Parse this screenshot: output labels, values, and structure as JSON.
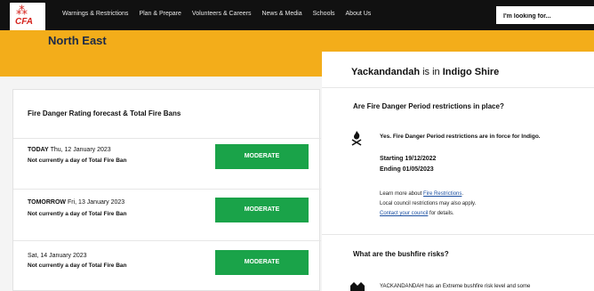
{
  "nav": {
    "logo_text": "CFA",
    "items": [
      "Warnings & Restrictions",
      "Plan & Prepare",
      "Volunteers & Careers",
      "News & Media",
      "Schools",
      "About Us"
    ],
    "search_placeholder": "I'm looking for..."
  },
  "header": {
    "region": "North East"
  },
  "forecast": {
    "title": "Fire Danger Rating forecast & Total Fire Bans",
    "days": [
      {
        "label": "TODAY",
        "date": "Thu, 12 January 2023",
        "tfb": "Not currently a day of Total Fire Ban",
        "rating": "MODERATE"
      },
      {
        "label": "TOMORROW",
        "date": "Fri, 13 January 2023",
        "tfb": "Not currently a day of Total Fire Ban",
        "rating": "MODERATE"
      },
      {
        "label": "",
        "date": "Sat, 14 January 2023",
        "tfb": "Not currently a day of Total Fire Ban",
        "rating": "MODERATE"
      }
    ]
  },
  "location": {
    "town": "Yackandandah",
    "middle": " is in ",
    "shire": "Indigo Shire"
  },
  "restrictions": {
    "question": "Are Fire Danger Period restrictions in place?",
    "answer": "Yes. Fire Danger Period restrictions are in force for Indigo.",
    "starting": "Starting 19/12/2022",
    "ending": "Ending 01/05/2023",
    "learn_prefix": "Learn more about ",
    "learn_link": "Fire Restrictions",
    "learn_suffix": ".",
    "local": "Local council restrictions may also apply.",
    "contact_link": "Contact your council",
    "contact_suffix": " for details."
  },
  "risks": {
    "question": "What are the bushfire risks?",
    "text": "YACKANDANDAH has an Extreme bushfire risk level and some"
  },
  "colors": {
    "brand_yellow": "#f3ad1a",
    "moderate_green": "#1aa349",
    "nav_black": "#111111",
    "cfa_red": "#d5231c"
  }
}
